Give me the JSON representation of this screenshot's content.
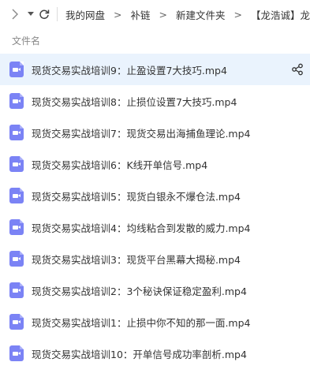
{
  "toolbar": {
    "forward_icon": "chevron-right-icon",
    "dropdown_icon": "caret-down-icon",
    "refresh_icon": "refresh-icon",
    "breadcrumbs": [
      "我的网盘",
      "补链",
      "新建文件夹",
      "【龙浩诚】龙"
    ],
    "separator": ">"
  },
  "list": {
    "column_header": "文件名",
    "files": [
      {
        "name": "现货交易实战培训9：止盈设置7大技巧.mp4",
        "hover": true
      },
      {
        "name": "现货交易实战培训8：止损位设置7大技巧.mp4"
      },
      {
        "name": "现货交易实战培训7：现货交易出海捕鱼理论.mp4"
      },
      {
        "name": "现货交易实战培训6：K线开单信号.mp4"
      },
      {
        "name": "现货交易实战培训5：现货白银永不爆仓法.mp4"
      },
      {
        "name": "现货交易实战培训4：均线粘合到发散的威力.mp4"
      },
      {
        "name": "现货交易实战培训3：现货平台黑幕大揭秘.mp4"
      },
      {
        "name": "现货交易实战培训2：3个秘诀保证稳定盈利.mp4"
      },
      {
        "name": "现货交易实战培训1：止损中你不知的那一面.mp4"
      },
      {
        "name": "现货交易实战培训10：开单信号成功率剖析.mp4"
      }
    ],
    "file_icon": "video-file-icon",
    "row_action_icon": "share-icon",
    "icon_color": "#7b83f5",
    "hover_color": "#eaf3fd"
  }
}
